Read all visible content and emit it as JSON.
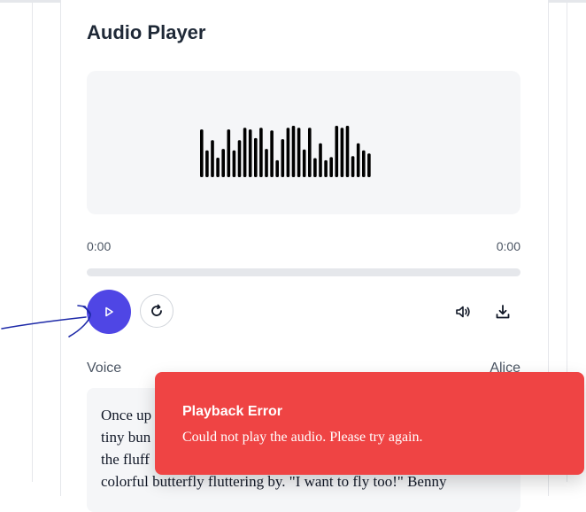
{
  "player": {
    "title": "Audio Player",
    "current_time": "0:00",
    "duration": "0:00",
    "progress": 0,
    "waveform_levels": [
      0.93,
      0.52,
      0.72,
      0.38,
      0.55,
      0.93,
      0.52,
      0.72,
      0.96,
      0.93,
      0.76,
      0.96,
      0.55,
      0.91,
      0.33,
      0.74,
      0.96,
      1.0,
      0.96,
      0.54,
      0.96,
      0.37,
      0.66,
      0.33,
      0.39,
      1.0,
      0.96,
      1.0,
      0.41,
      0.66,
      0.52,
      0.46
    ],
    "accent_color": "#4f46e5"
  },
  "controls": {
    "play_icon": "play-icon",
    "replay_icon": "replay-icon",
    "volume_icon": "volume-icon",
    "download_icon": "download-icon"
  },
  "voice": {
    "label": "Voice",
    "value": "Alice"
  },
  "story": {
    "lines": [
      "Once up",
      "tiny bun",
      "the fluff",
      "colorful butterfly fluttering by. \"I want to fly too!\" Benny"
    ]
  },
  "toast": {
    "title": "Playback Error",
    "message": "Could not play the audio. Please try again.",
    "color": "#ef4444"
  }
}
